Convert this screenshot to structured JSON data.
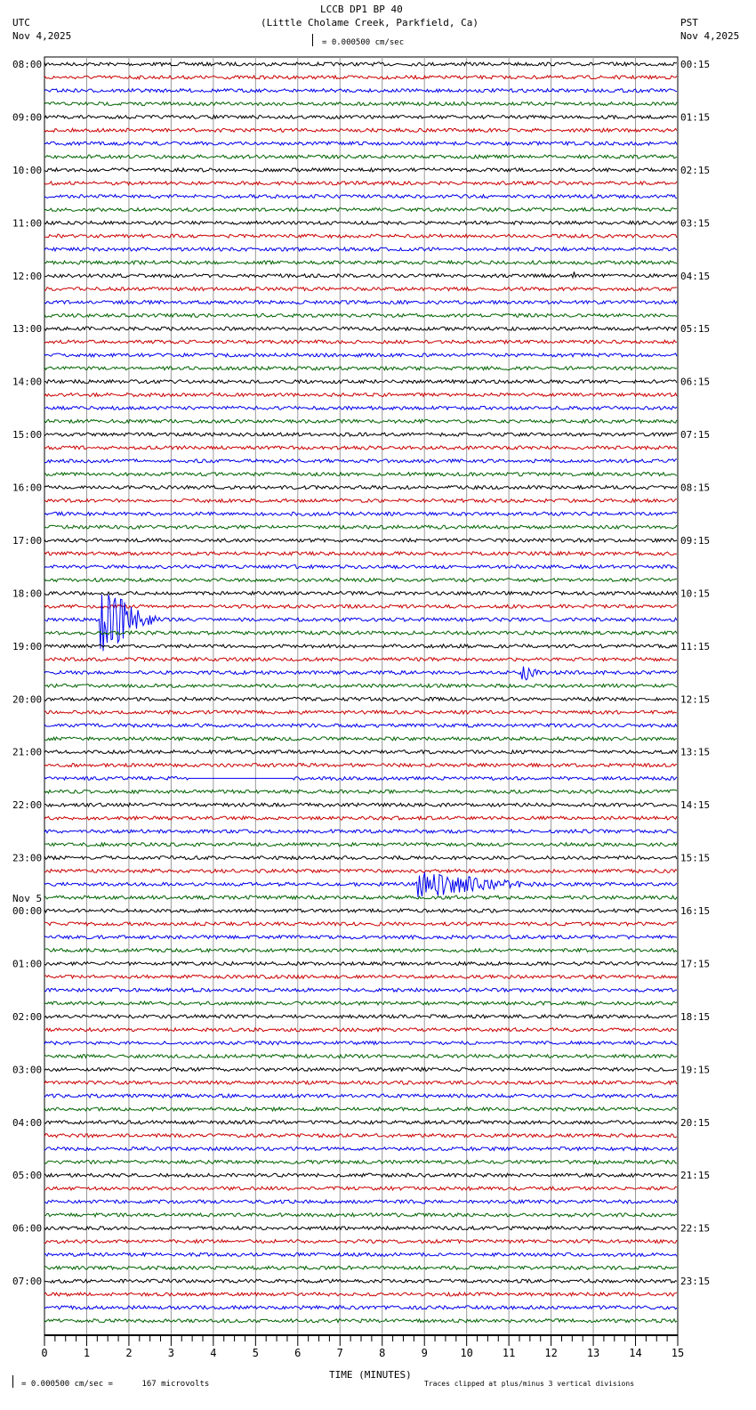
{
  "header": {
    "title": "LCCB DP1 BP 40",
    "subtitle": "(Little Cholame Creek, Parkfield, Ca)",
    "left_tz": "UTC",
    "left_date": "Nov 4,2025",
    "right_tz": "PST",
    "right_date": "Nov 4,2025",
    "scale": "= 0.000500 cm/sec"
  },
  "footer": {
    "scale": "= 0.000500 cm/sec =      167 microvolts",
    "clip_note": "Traces clipped at plus/minus 3 vertical divisions"
  },
  "chart_data": {
    "type": "line",
    "title": "LCCB DP1 BP 40",
    "xlabel": "TIME (MINUTES)",
    "xlim": [
      0,
      15
    ],
    "x_ticks": [
      "0",
      "1",
      "2",
      "3",
      "4",
      "5",
      "6",
      "7",
      "8",
      "9",
      "10",
      "11",
      "12",
      "13",
      "14",
      "15"
    ],
    "rows_per_hour": 4,
    "trace_count": 96,
    "trace_colors": [
      "#000000",
      "#cc0000",
      "#0000ee",
      "#006400"
    ],
    "left_labels": [
      "08:00",
      "09:00",
      "10:00",
      "11:00",
      "12:00",
      "13:00",
      "14:00",
      "15:00",
      "16:00",
      "17:00",
      "18:00",
      "19:00",
      "20:00",
      "21:00",
      "22:00",
      "23:00",
      "00:00",
      "01:00",
      "02:00",
      "03:00",
      "04:00",
      "05:00",
      "06:00",
      "07:00"
    ],
    "date_change_label": "Nov 5",
    "right_labels": [
      "00:15",
      "01:15",
      "02:15",
      "03:15",
      "04:15",
      "05:15",
      "06:15",
      "07:15",
      "08:15",
      "09:15",
      "10:15",
      "11:15",
      "12:15",
      "13:15",
      "14:15",
      "15:15",
      "16:15",
      "17:15",
      "18:15",
      "19:15",
      "20:15",
      "21:15",
      "22:15",
      "23:15"
    ],
    "events": [
      {
        "row": 42,
        "start_min": 1.3,
        "end_min": 3.0,
        "amplitude": 3.0
      },
      {
        "row": 46,
        "start_min": 11.3,
        "end_min": 12.0,
        "amplitude": 0.6
      },
      {
        "row": 62,
        "start_min": 8.8,
        "end_min": 12.5,
        "amplitude": 1.0
      },
      {
        "row": 16,
        "start_min": 12.5,
        "end_min": 12.6,
        "amplitude": 0.6
      }
    ],
    "flat_segments": [
      {
        "row": 54,
        "start_min": 3.4,
        "end_min": 5.9
      }
    ]
  }
}
